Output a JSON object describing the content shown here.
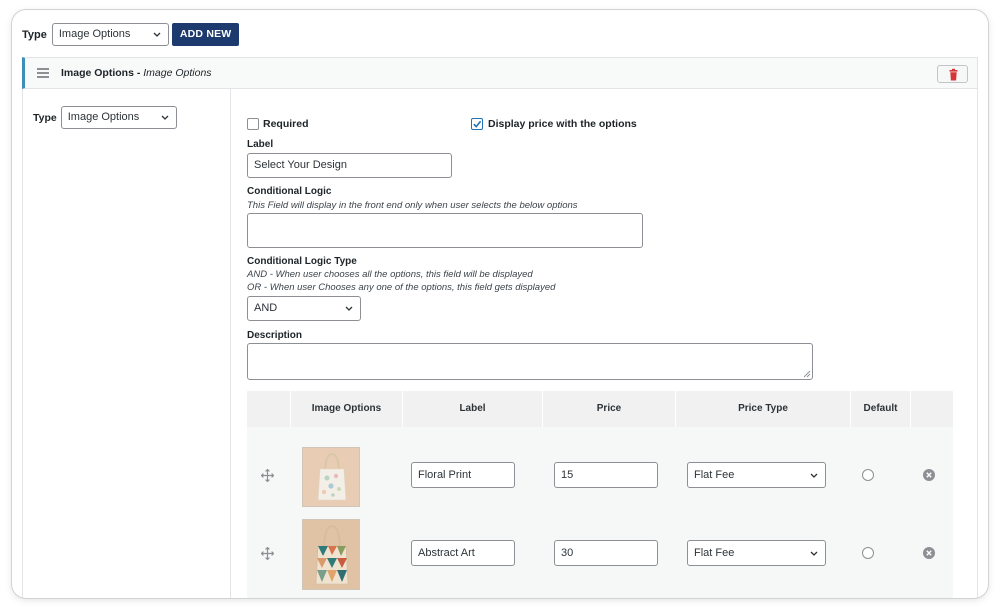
{
  "top": {
    "type_label": "Type",
    "type_select_value": "Image Options",
    "add_new_label": "ADD NEW"
  },
  "field_header": {
    "title_bold": "Image Options -",
    "title_italic": "Image Options"
  },
  "left": {
    "type_label": "Type",
    "type_select_value": "Image Options"
  },
  "settings": {
    "required_label": "Required",
    "required_checked": false,
    "display_price_label": "Display price with the options",
    "display_price_checked": true,
    "label_heading": "Label",
    "label_value": "Select Your Design",
    "conditional_heading": "Conditional Logic",
    "conditional_note": "This Field will display in the front end only when user selects the below options",
    "cond_type_heading": "Conditional Logic Type",
    "cond_type_note_and": "AND - When user chooses all the options, this field will be displayed",
    "cond_type_note_or": "OR - When user Chooses any one of the options, this field gets displayed",
    "cond_type_value": "AND",
    "description_heading": "Description"
  },
  "table": {
    "headers": [
      "Image Options",
      "Label",
      "Price",
      "Price Type",
      "Default"
    ],
    "rows": [
      {
        "image": "floral-tote-bag-image",
        "label": "Floral Print",
        "price": "15",
        "price_type": "Flat Fee"
      },
      {
        "image": "abstract-tote-bag-image",
        "label": "Abstract Art",
        "price": "30",
        "price_type": "Flat Fee"
      }
    ]
  },
  "colors": {
    "primary_button": "#1d3a6e",
    "accent_border": "#3d8eb9",
    "delete_icon": "#d63638",
    "checkbox_check": "#2271b1"
  }
}
